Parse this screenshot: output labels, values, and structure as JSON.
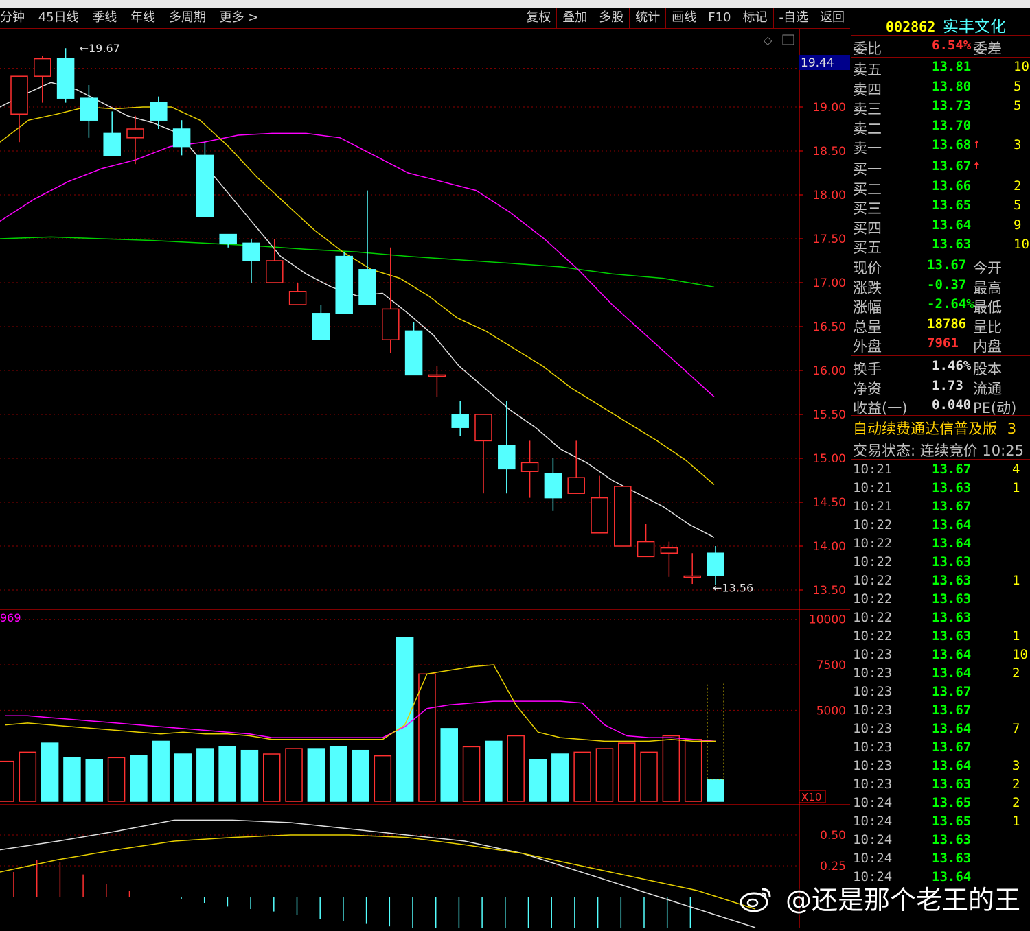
{
  "toolbar": {
    "periods": [
      "分钟",
      "45日线",
      "季线",
      "年线",
      "多周期",
      "更多 >"
    ],
    "actions": [
      "复权",
      "叠加",
      "多股",
      "统计",
      "画线",
      "F10",
      "标记",
      "-自选",
      "返回"
    ]
  },
  "price_chart": {
    "high_label": "19.67",
    "low_label": "13.56",
    "current_marker": "19.44",
    "y_ticks": [
      "19.00",
      "18.50",
      "18.00",
      "17.50",
      "17.00",
      "16.50",
      "16.00",
      "15.50",
      "15.00",
      "14.50",
      "14.00",
      "13.50"
    ]
  },
  "volume_chart": {
    "indicator_value": "969",
    "y_ticks": [
      "10000",
      "7500",
      "5000"
    ],
    "unit": "X10"
  },
  "macd_chart": {
    "y_ticks": [
      "0.50",
      "0.25"
    ]
  },
  "chart_data": [
    {
      "type": "candlestick",
      "x": [
        1,
        2,
        3,
        4,
        5,
        6,
        7,
        8,
        9,
        10,
        11,
        12,
        13,
        14,
        15,
        16,
        17,
        18,
        19,
        20,
        21,
        22,
        23,
        24,
        25,
        26,
        27,
        28,
        29,
        30,
        31
      ],
      "open": [
        18.92,
        19.35,
        19.55,
        19.1,
        18.7,
        18.65,
        19.05,
        18.75,
        18.45,
        17.55,
        17.45,
        17.0,
        16.75,
        16.65,
        17.3,
        17.15,
        16.35,
        16.45,
        15.95,
        15.5,
        15.2,
        15.15,
        14.85,
        14.83,
        14.6,
        14.15,
        14.0,
        13.88,
        13.92,
        13.66,
        13.92
      ],
      "high": [
        19.1,
        19.58,
        19.67,
        19.25,
        18.95,
        18.9,
        19.12,
        18.85,
        18.6,
        17.55,
        17.5,
        17.5,
        17.0,
        16.75,
        17.35,
        18.05,
        17.4,
        16.55,
        16.05,
        15.65,
        15.3,
        15.65,
        15.2,
        15.0,
        15.2,
        14.8,
        14.6,
        14.25,
        14.05,
        13.92,
        14.0
      ],
      "low": [
        18.6,
        19.05,
        19.05,
        18.65,
        18.55,
        18.35,
        18.75,
        18.45,
        18.0,
        17.4,
        17.0,
        17.1,
        16.8,
        16.35,
        16.65,
        16.78,
        16.2,
        15.95,
        15.7,
        15.25,
        14.6,
        14.6,
        14.55,
        14.4,
        14.65,
        14.48,
        14.08,
        13.95,
        13.65,
        13.57,
        13.56
      ],
      "close": [
        19.35,
        19.55,
        19.1,
        18.85,
        18.45,
        18.75,
        18.85,
        18.55,
        17.75,
        17.45,
        17.25,
        17.25,
        16.9,
        16.35,
        16.65,
        16.75,
        16.7,
        15.95,
        15.95,
        15.35,
        15.5,
        14.88,
        14.95,
        14.55,
        14.78,
        14.55,
        14.68,
        14.05,
        13.98,
        13.66,
        13.67
      ],
      "ma_white": [
        19.0,
        19.15,
        19.28,
        19.2,
        19.05,
        18.9,
        18.82,
        18.7,
        18.35,
        18.0,
        17.65,
        17.3,
        17.1,
        16.95,
        16.85,
        16.88,
        16.65,
        16.4,
        16.05,
        15.8,
        15.55,
        15.35,
        15.1,
        14.95,
        14.75,
        14.6,
        14.45,
        14.25,
        14.1
      ],
      "ma_yellow": [
        18.6,
        18.85,
        18.92,
        19.0,
        18.98,
        19.0,
        19.0,
        18.85,
        18.55,
        18.2,
        17.9,
        17.6,
        17.35,
        17.15,
        17.05,
        16.85,
        16.6,
        16.45,
        16.25,
        16.05,
        15.8,
        15.6,
        15.4,
        15.2,
        14.98,
        14.7
      ],
      "ma_magenta": [
        17.7,
        17.95,
        18.15,
        18.3,
        18.4,
        18.55,
        18.6,
        18.68,
        18.7,
        18.7,
        18.65,
        18.45,
        18.25,
        18.15,
        18.05,
        17.8,
        17.5,
        17.15,
        16.75,
        16.4,
        16.05,
        15.7
      ],
      "ma_green": [
        17.5,
        17.52,
        17.5,
        17.48,
        17.45,
        17.42,
        17.38,
        17.35,
        17.3,
        17.26,
        17.22,
        17.18,
        17.1,
        17.05,
        16.95
      ]
    },
    {
      "type": "bar",
      "up": [
        true,
        true,
        true,
        false,
        false,
        false,
        false,
        true,
        false,
        false,
        false,
        false,
        false,
        false,
        true,
        false,
        true,
        false,
        false,
        false,
        true,
        false,
        true,
        false,
        false,
        false,
        false,
        false,
        false,
        false,
        false
      ],
      "values": [
        2200,
        2700,
        3200,
        2400,
        2300,
        2400,
        2500,
        3300,
        2600,
        2900,
        3000,
        2800,
        2600,
        2900,
        2900,
        3000,
        2800,
        2500,
        9000,
        7000,
        4000,
        3000,
        3300,
        3600,
        2300,
        2600,
        2700,
        2900,
        3200,
        2700,
        3600,
        3400,
        1200
      ],
      "ma_yellow": [
        4200,
        4300,
        4200,
        4100,
        4000,
        3900,
        3800,
        3700,
        3800,
        3700,
        3700,
        3600,
        3400,
        3400,
        3400,
        3400,
        3400,
        3400,
        4200,
        7000,
        7200,
        7400,
        7500,
        5300,
        3800,
        3500,
        3400,
        3300,
        3300,
        3300,
        3400,
        3300,
        3300
      ],
      "ma_magenta": [
        4700,
        4700,
        4600,
        4500,
        4400,
        4300,
        4200,
        4100,
        4000,
        3900,
        3800,
        3700,
        3500,
        3500,
        3500,
        3500,
        3500,
        3500,
        4100,
        5100,
        5300,
        5400,
        5500,
        5500,
        5500,
        5500,
        5400,
        4200,
        3600,
        3500,
        3500,
        3400,
        3300
      ]
    },
    {
      "type": "line",
      "white": [
        0.38,
        0.45,
        0.53,
        0.62,
        0.62,
        0.6,
        0.55,
        0.5,
        0.45,
        0.35,
        0.2,
        0.05,
        -0.1,
        -0.25
      ],
      "yellow": [
        0.2,
        0.3,
        0.38,
        0.45,
        0.48,
        0.5,
        0.5,
        0.48,
        0.42,
        0.35,
        0.25,
        0.15,
        0.05,
        -0.1
      ],
      "hist_up": [
        0.2,
        0.3,
        0.28,
        0.18,
        0.1,
        0.05
      ],
      "hist_down": [
        0.02,
        0.05,
        0.08,
        0.1,
        0.12,
        0.15,
        0.18,
        0.2,
        0.22,
        0.24,
        0.26,
        0.28,
        0.3,
        0.3,
        0.32,
        0.32,
        0.34,
        0.34,
        0.35,
        0.36,
        0.36,
        0.37,
        0.37
      ]
    }
  ],
  "quote": {
    "code": "002862",
    "name": "实丰文化",
    "weibi_label": "委比",
    "weibi_value": "6.54%",
    "weicha_label": "委差",
    "asks": [
      {
        "label": "卖五",
        "price": "13.81",
        "vol": "10"
      },
      {
        "label": "卖四",
        "price": "13.80",
        "vol": "5"
      },
      {
        "label": "卖三",
        "price": "13.73",
        "vol": "5"
      },
      {
        "label": "卖二",
        "price": "13.70",
        "vol": ""
      },
      {
        "label": "卖一",
        "price": "13.68",
        "vol": "3",
        "arrow": "🠅"
      }
    ],
    "bids": [
      {
        "label": "买一",
        "price": "13.67",
        "vol": "",
        "arrow": "🠅"
      },
      {
        "label": "买二",
        "price": "13.66",
        "vol": "2"
      },
      {
        "label": "买三",
        "price": "13.65",
        "vol": "5"
      },
      {
        "label": "买四",
        "price": "13.64",
        "vol": "9"
      },
      {
        "label": "买五",
        "price": "13.63",
        "vol": "10"
      }
    ],
    "stats": [
      {
        "label": "现价",
        "value": "13.67",
        "right": "今开",
        "color": "#00ff00"
      },
      {
        "label": "涨跌",
        "value": "-0.37",
        "right": "最高",
        "color": "#00ff00"
      },
      {
        "label": "涨幅",
        "value": "-2.64%",
        "right": "最低",
        "color": "#00ff00"
      },
      {
        "label": "总量",
        "value": "18786",
        "right": "量比",
        "color": "#ffff00"
      },
      {
        "label": "外盘",
        "value": "7961",
        "right": "内盘",
        "color": "#ff3030"
      }
    ],
    "stats2": [
      {
        "label": "换手",
        "value": "1.46%",
        "right": "股本"
      },
      {
        "label": "净资",
        "value": "1.73",
        "right": "流通"
      },
      {
        "label": "收益(一)",
        "value": "0.040",
        "right": "PE(动)"
      }
    ],
    "promo": "自动续费通达信普及版",
    "promo_tail": "3",
    "status": "交易状态: 连续竞价 10:25"
  },
  "ticks": [
    {
      "time": "10:21",
      "price": "13.67",
      "vol": "4"
    },
    {
      "time": "10:21",
      "price": "13.63",
      "vol": "1"
    },
    {
      "time": "10:21",
      "price": "13.67",
      "vol": ""
    },
    {
      "time": "10:22",
      "price": "13.64",
      "vol": ""
    },
    {
      "time": "10:22",
      "price": "13.64",
      "vol": ""
    },
    {
      "time": "10:22",
      "price": "13.63",
      "vol": ""
    },
    {
      "time": "10:22",
      "price": "13.63",
      "vol": "1"
    },
    {
      "time": "10:22",
      "price": "13.63",
      "vol": ""
    },
    {
      "time": "10:22",
      "price": "13.63",
      "vol": ""
    },
    {
      "time": "10:22",
      "price": "13.63",
      "vol": "1"
    },
    {
      "time": "10:23",
      "price": "13.64",
      "vol": "10"
    },
    {
      "time": "10:23",
      "price": "13.64",
      "vol": "2"
    },
    {
      "time": "10:23",
      "price": "13.67",
      "vol": ""
    },
    {
      "time": "10:23",
      "price": "13.67",
      "vol": ""
    },
    {
      "time": "10:23",
      "price": "13.64",
      "vol": "7"
    },
    {
      "time": "10:23",
      "price": "13.67",
      "vol": ""
    },
    {
      "time": "10:23",
      "price": "13.64",
      "vol": "3"
    },
    {
      "time": "10:23",
      "price": "13.63",
      "vol": "2"
    },
    {
      "time": "10:24",
      "price": "13.65",
      "vol": "2"
    },
    {
      "time": "10:24",
      "price": "13.65",
      "vol": "1"
    },
    {
      "time": "10:24",
      "price": "13.63",
      "vol": ""
    },
    {
      "time": "10:24",
      "price": "13.63",
      "vol": ""
    },
    {
      "time": "10:24",
      "price": "13.64",
      "vol": ""
    }
  ],
  "watermark": "@还是那个老王的王",
  "colors": {
    "up": "#ff3030",
    "down": "#54ffff",
    "grid": "#8b0000",
    "axis": "#ff0000",
    "ma_white": "#e0e0e0",
    "ma_yellow": "#e8d000",
    "ma_magenta": "#ff00ff",
    "ma_green": "#00d000"
  }
}
